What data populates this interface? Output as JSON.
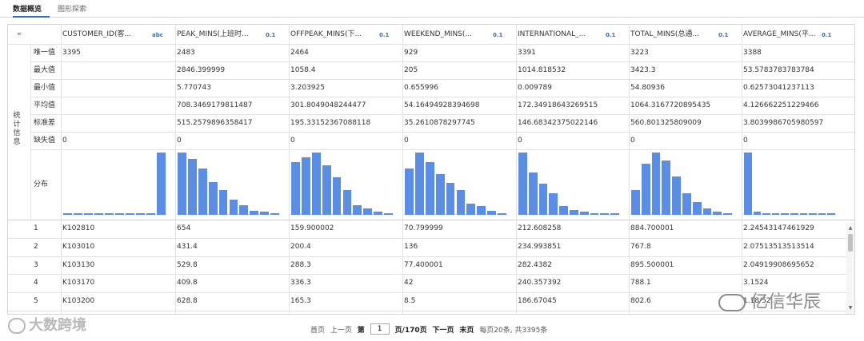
{
  "tabs": [
    {
      "label": "数据概览",
      "active": true
    },
    {
      "label": "图形探索",
      "active": false
    }
  ],
  "accent_color": "#2b6fcf",
  "bar_color": "#5a8ee6",
  "side_label": [
    "统",
    "计",
    "信",
    "息"
  ],
  "collapse_icon": "double-chevron-down-icon",
  "columns": [
    {
      "header": "CUSTOMER_ID(客...",
      "type": "abc"
    },
    {
      "header": "PEAK_MINS(上班时...",
      "type": "0.1"
    },
    {
      "header": "OFFPEAK_MINS(下...",
      "type": "0.1"
    },
    {
      "header": "WEEKEND_MINS(...",
      "type": "0.1"
    },
    {
      "header": "INTERNATIONAL_...",
      "type": "0.1"
    },
    {
      "header": "TOTAL_MINS(总通...",
      "type": "0.1"
    },
    {
      "header": "AVERAGE_MINS(平...",
      "type": "0.1"
    }
  ],
  "stats": [
    {
      "label": "唯一值",
      "values": [
        "3395",
        "2483",
        "2464",
        "929",
        "3391",
        "3223",
        "3388"
      ]
    },
    {
      "label": "最大值",
      "values": [
        "",
        "2846.399999",
        "1058.4",
        "205",
        "1014.818532",
        "3423.3",
        "53.5783783783784"
      ]
    },
    {
      "label": "最小值",
      "values": [
        "",
        "5.770743",
        "3.203925",
        "0.655996",
        "0.009789",
        "54.80936",
        "0.62573041237113"
      ]
    },
    {
      "label": "平均值",
      "values": [
        "",
        "708.3469179811487",
        "301.8049048244477",
        "54.16494928394698",
        "172.34918643269515",
        "1064.3167720895435",
        "4.126662251229466"
      ]
    },
    {
      "label": "标准差",
      "values": [
        "",
        "515.2579896358417",
        "195.33152367088118",
        "35.2610878297745",
        "146.68342375022146",
        "560.801325809009",
        "3.8039986705980597"
      ]
    },
    {
      "label": "缺失值",
      "values": [
        "0",
        "0",
        "0",
        "0",
        "0",
        "0",
        "0"
      ]
    }
  ],
  "distribution_label": "分布",
  "chart_data": {
    "type": "bar",
    "series": [
      {
        "values": [
          2,
          2,
          2,
          2,
          2,
          2,
          2,
          2,
          2,
          100
        ]
      },
      {
        "values": [
          100,
          90,
          75,
          52,
          40,
          25,
          15,
          6,
          5,
          2
        ]
      },
      {
        "values": [
          85,
          92,
          100,
          80,
          60,
          40,
          15,
          10,
          5,
          2
        ]
      },
      {
        "values": [
          75,
          100,
          84,
          66,
          51,
          40,
          18,
          14,
          6,
          2
        ]
      },
      {
        "values": [
          100,
          68,
          50,
          34,
          14,
          8,
          5,
          2,
          2,
          2
        ]
      },
      {
        "values": [
          40,
          82,
          100,
          87,
          62,
          35,
          20,
          10,
          5,
          2
        ]
      },
      {
        "values": [
          100,
          5,
          2,
          2,
          2,
          2,
          2,
          2,
          2,
          2
        ]
      }
    ]
  },
  "rows": [
    {
      "index": "1",
      "values": [
        "K102810",
        "654",
        "159.900002",
        "70.799999",
        "212.608258",
        "884.700001",
        "2.24543147461929"
      ]
    },
    {
      "index": "2",
      "values": [
        "K103010",
        "431.4",
        "200.4",
        "136",
        "234.993851",
        "767.8",
        "2.07513513513514"
      ]
    },
    {
      "index": "3",
      "values": [
        "K103130",
        "529.8",
        "288.3",
        "77.400001",
        "282.4382",
        "895.500001",
        "2.04919908695652"
      ]
    },
    {
      "index": "4",
      "values": [
        "K103170",
        "409.8",
        "336.3",
        "42",
        "240.357392",
        "788.1",
        "3.1524"
      ]
    },
    {
      "index": "5",
      "values": [
        "K103200",
        "628.8",
        "165.3",
        "8.5",
        "186.67045",
        "802.6",
        "1.18/52..."
      ]
    }
  ],
  "pager": {
    "first": "首页",
    "prev": "上一页",
    "page_prefix": "第",
    "page_value": "1",
    "page_suffix": "页/170页",
    "next": "下一页",
    "last": "末页",
    "summary": "每页20条, 共3395条"
  },
  "watermark_left": "大数跨境",
  "watermark_right": "亿信华辰"
}
